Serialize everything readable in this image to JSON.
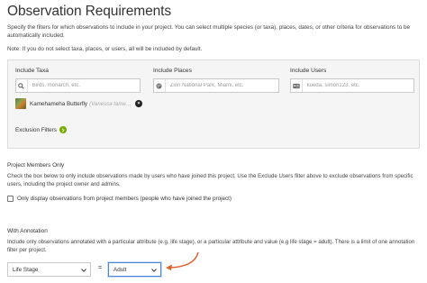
{
  "header": {
    "title": "Observation Requirements",
    "intro": "Specify the filters for which observations to include in your project. You can select multiple species (or taxa), places, dates, or other criteria for observations to be automatically included.",
    "note": "Note: If you do not select taxa, places, or users, all will be included by default."
  },
  "filters": {
    "taxa": {
      "label": "Include Taxa",
      "placeholder": "Birds, monarch, etc.",
      "icon": "search-icon"
    },
    "places": {
      "label": "Include Places",
      "placeholder": "Zion National Park, Miami, etc.",
      "icon": "globe-icon"
    },
    "users": {
      "label": "Include Users",
      "placeholder": "kueda, simon123, etc.",
      "icon": "id-card-icon"
    },
    "selected_taxon": {
      "common_name": "Kamehameha Butterfly",
      "scientific_name": "(Vanessa tame…"
    },
    "exclusion_label": "Exclusion Filters",
    "colors": {
      "accent": "#74ac00"
    }
  },
  "members": {
    "heading": "Project Members Only",
    "description": "Check the box below to only include observations made by users who have joined this project. Use the Exclude Users filter above to exclude observations from specific users, including the project owner and admins.",
    "checkbox_label": "Only display observations from project members (people who have joined the project)",
    "checked": false
  },
  "annotation": {
    "heading": "With Annotation",
    "description": "Include only observations annotated with a particular attribute (e.g. life stage), or a particular attribute and value (e.g life stage = adult). There is a limit of one annotation filter per project.",
    "attribute_value": "Life Stage",
    "equals": "=",
    "value_selected": "Adult",
    "arrow_color": "#e2622e"
  }
}
